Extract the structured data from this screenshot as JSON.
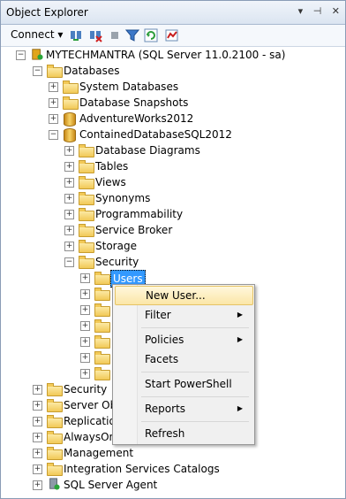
{
  "panel": {
    "title": "Object Explorer",
    "pin_glyph": "▾",
    "autohide_glyph": "⊣",
    "close_glyph": "✕"
  },
  "toolbar": {
    "connect_label": "Connect ▾"
  },
  "tree": {
    "server": "MYTECHMANTRA (SQL Server 11.0.2100 - sa)",
    "databases": "Databases",
    "system_databases": "System Databases",
    "snapshots": "Database Snapshots",
    "adventureworks": "AdventureWorks2012",
    "contained": "ContainedDatabaseSQL2012",
    "diagrams": "Database Diagrams",
    "tables": "Tables",
    "views": "Views",
    "synonyms": "Synonyms",
    "programmability": "Programmability",
    "service_broker": "Service Broker",
    "storage": "Storage",
    "security": "Security",
    "users": "Users",
    "server_security": "Security",
    "server_objects": "Server Obje",
    "replication": "Replication",
    "alwayson": "AlwaysOn",
    "management": "Management",
    "isc": "Integration Services Catalogs",
    "agent": "SQL Server Agent"
  },
  "context_menu": {
    "new_user": "New User...",
    "filter": "Filter",
    "policies": "Policies",
    "facets": "Facets",
    "powershell": "Start PowerShell",
    "reports": "Reports",
    "refresh": "Refresh",
    "submenu_arrow": "▶"
  },
  "colors": {
    "selection": "#3399ff",
    "highlight": "#fbe6a7",
    "title_bg": "#dbe5f1"
  }
}
